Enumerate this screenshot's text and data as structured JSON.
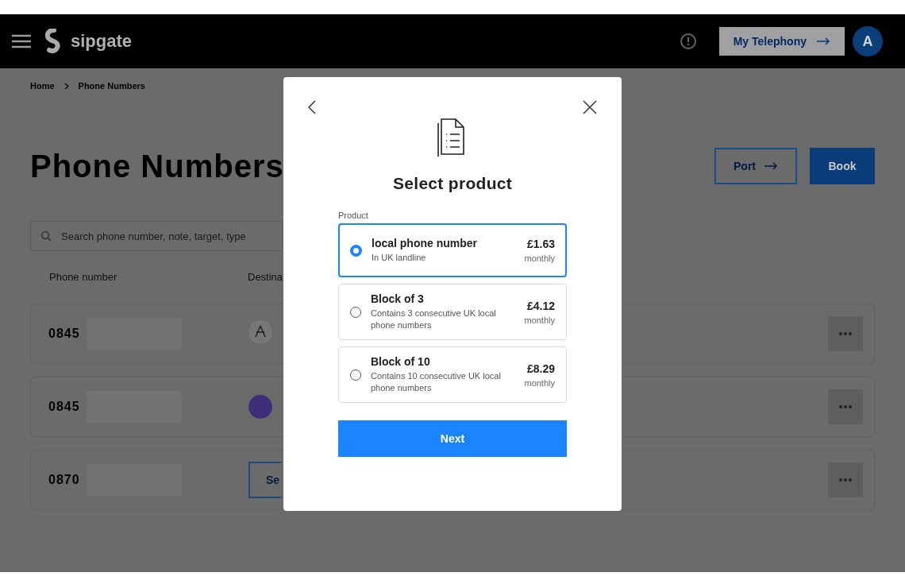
{
  "header": {
    "logo": "sipgate",
    "telephony_button": "My Telephony",
    "avatar": "A"
  },
  "breadcrumb": [
    "Home",
    "Phone Numbers"
  ],
  "page_title": "Phone Numbers",
  "actions": [
    {
      "label": "Port",
      "kind": "outline"
    },
    {
      "label": "Book",
      "kind": "primary"
    }
  ],
  "search": {
    "placeholder": "Search phone number, note, target, type"
  },
  "table": {
    "columns": [
      "Phone number",
      "Destina"
    ],
    "rows": [
      {
        "prefix": "0845",
        "destination": {
          "kind": "icon"
        }
      },
      {
        "prefix": "0845",
        "destination": {
          "kind": "avatar",
          "color": "#3f2f7a"
        }
      },
      {
        "prefix": "0870",
        "destination": {
          "kind": "button",
          "label": "Se"
        }
      }
    ]
  },
  "modal": {
    "title": "Select product",
    "field_label": "Product",
    "options": [
      {
        "title": "local phone number",
        "description": "In UK landline",
        "price": "£1.63",
        "period": "monthly",
        "selected": true
      },
      {
        "title": "Block of 3",
        "description": "Contains 3 consecutive UK local phone numbers",
        "price": "£4.12",
        "period": "monthly",
        "selected": false
      },
      {
        "title": "Block of 10",
        "description": "Contains 10 consecutive UK local phone numbers",
        "price": "£8.29",
        "period": "monthly",
        "selected": false
      }
    ],
    "next_button": "Next"
  }
}
